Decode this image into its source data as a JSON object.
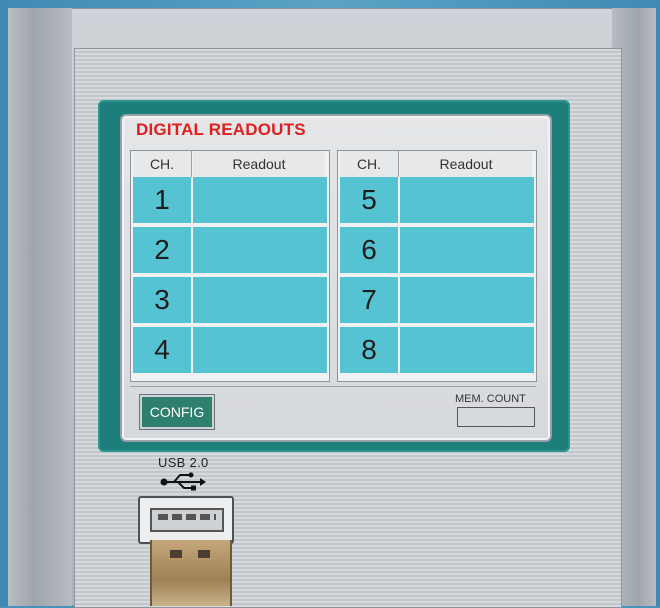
{
  "screen": {
    "title": "DIGITAL READOUTS",
    "headers": {
      "channel": "CH.",
      "readout": "Readout"
    },
    "left_channels": [
      "1",
      "2",
      "3",
      "4"
    ],
    "right_channels": [
      "5",
      "6",
      "7",
      "8"
    ],
    "config_label": "CONFIG",
    "mem_count_label": "MEM. COUNT"
  },
  "device": {
    "usb_label": "USB 2.0"
  },
  "colors": {
    "title": "#e02020",
    "cell_fill": "#56c3d2",
    "frame": "#1c7f79",
    "config_button": "#2f7f6e"
  },
  "icons": {
    "usb": "usb-trident-icon"
  }
}
